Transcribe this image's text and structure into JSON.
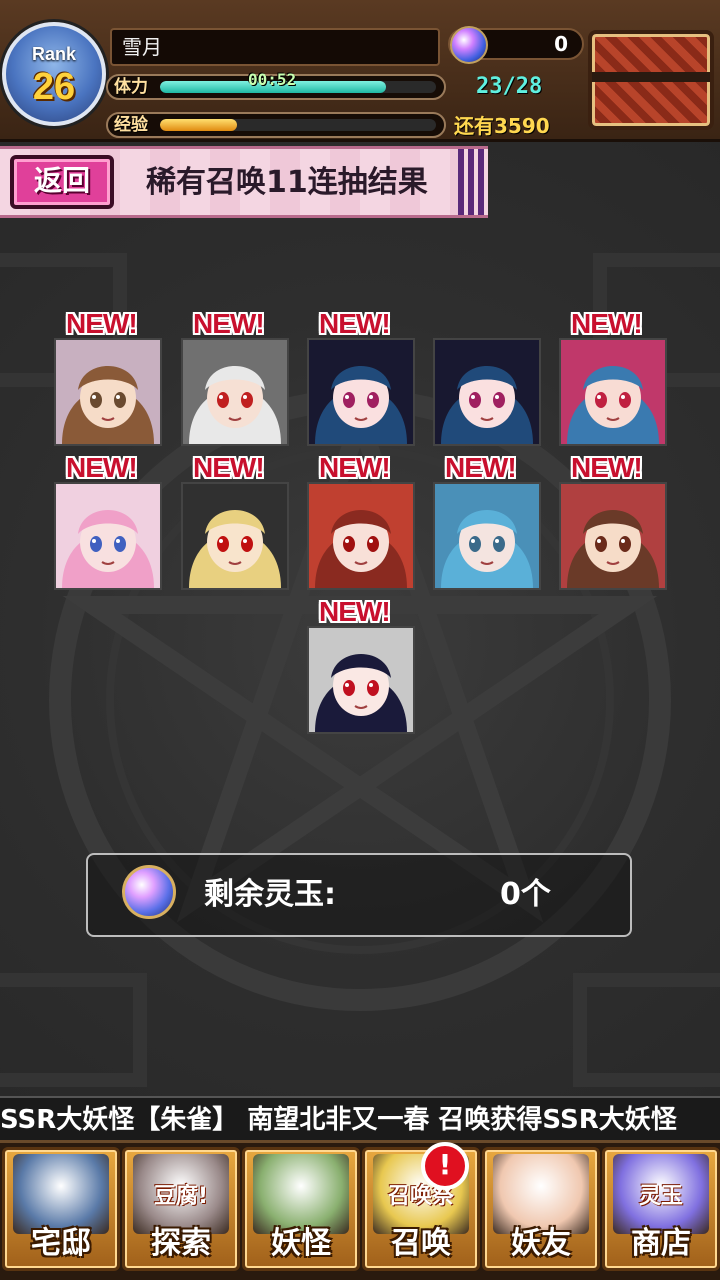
{
  "status": {
    "rank_label": "Rank",
    "rank": "26",
    "player_name": "雪月",
    "stamina_label": "体力",
    "stamina_timer": "00:52",
    "stamina_value": "23/28",
    "stamina_fraction": 0.82,
    "exp_label": "经验",
    "exp_remaining": "还有3590",
    "exp_fraction": 0.28,
    "orb_count": "0"
  },
  "header": {
    "back_label": "返回",
    "title": "稀有召唤11连抽结果"
  },
  "results": {
    "new_tag": "NEW!",
    "cards": [
      {
        "hair": "#8a5a38",
        "skin": "#f6dcc8",
        "eyes": "#6a4a30",
        "bg": "#c8b0c0",
        "is_new": true
      },
      {
        "hair": "#e8e8e8",
        "skin": "#f6e0d4",
        "eyes": "#c02020",
        "bg": "#707070",
        "is_new": true
      },
      {
        "hair": "#204a7a",
        "skin": "#fae0e0",
        "eyes": "#a02060",
        "bg": "#181830",
        "is_new": true
      },
      {
        "hair": "#204a7a",
        "skin": "#fae0e0",
        "eyes": "#a02060",
        "bg": "#181830",
        "is_new": false
      },
      {
        "hair": "#3a7ab0",
        "skin": "#f8dcd4",
        "eyes": "#c02040",
        "bg": "#c0386a",
        "is_new": true
      },
      {
        "hair": "#f0a0c8",
        "skin": "#f8e0e0",
        "eyes": "#4060c0",
        "bg": "#f0d0e0",
        "is_new": true
      },
      {
        "hair": "#e8d080",
        "skin": "#f8e4cc",
        "eyes": "#c01010",
        "bg": "#303030",
        "is_new": true
      },
      {
        "hair": "#8a2a20",
        "skin": "#f8e0d8",
        "eyes": "#a01010",
        "bg": "#c04030",
        "is_new": true
      },
      {
        "hair": "#5ab0d8",
        "skin": "#f4e4e0",
        "eyes": "#3a6a8a",
        "bg": "#4a90b8",
        "is_new": true
      },
      {
        "hair": "#6a3a28",
        "skin": "#f6dcc8",
        "eyes": "#6a2a1a",
        "bg": "#b04040",
        "is_new": true
      },
      {
        "hair": "#1a1a3a",
        "skin": "#fae8e4",
        "eyes": "#c01020",
        "bg": "#c8c8c8",
        "is_new": true
      }
    ]
  },
  "remaining": {
    "label": "剩余灵玉:",
    "value": "0个"
  },
  "ticker": {
    "text": "SSR大妖怪【朱雀】    南望北非又一春 召唤获得SSR大妖怪"
  },
  "nav": [
    {
      "name": "nav-home",
      "label": "宅邸",
      "art_color": "#5a7aa8",
      "icon": "house-icon"
    },
    {
      "name": "nav-explore",
      "label": "探索",
      "art_color": "#9a8a8a",
      "icon": "tofu-icon",
      "art_text": "豆腐!"
    },
    {
      "name": "nav-yokai",
      "label": "妖怪",
      "art_color": "#8ab070",
      "icon": "scroll-icon"
    },
    {
      "name": "nav-summon",
      "label": "召唤",
      "art_color": "#e8c850",
      "icon": "summon-star-icon",
      "art_text": "召唤祭",
      "badge": "!"
    },
    {
      "name": "nav-friends",
      "label": "妖友",
      "art_color": "#f0c8b0",
      "icon": "friend-icon"
    },
    {
      "name": "nav-shop",
      "label": "商店",
      "art_color": "#8070e0",
      "icon": "orb-icon",
      "art_text": "灵玉"
    }
  ],
  "colors": {
    "accent_pink": "#e0409a",
    "new_red": "#c8102e",
    "stamina": "#1fb8a4",
    "exp": "#e08a10"
  }
}
